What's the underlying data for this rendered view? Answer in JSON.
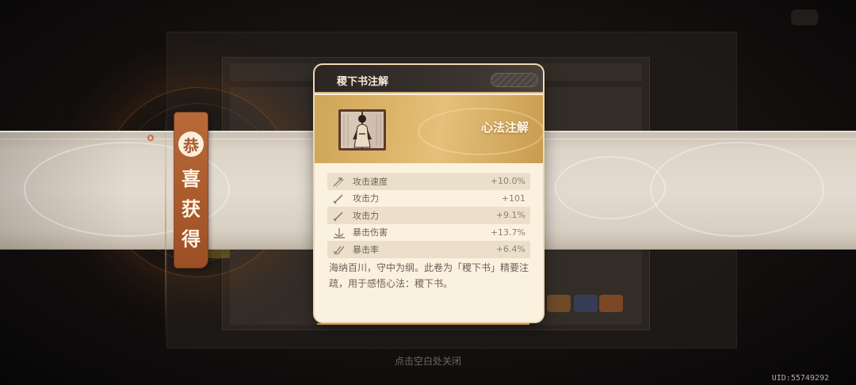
{
  "banner_label": {
    "circle_char": "恭",
    "chars": [
      "喜",
      "获",
      "得"
    ]
  },
  "item": {
    "name": "稷下书注解",
    "type": "心法注解",
    "stats": [
      {
        "icon": "attack-speed-icon",
        "name": "攻击速度",
        "value": "+10.0%"
      },
      {
        "icon": "attack-icon",
        "name": "攻击力",
        "value": "+101"
      },
      {
        "icon": "attack-icon",
        "name": "攻击力",
        "value": "+9.1%"
      },
      {
        "icon": "crit-damage-icon",
        "name": "暴击伤害",
        "value": "+13.7%"
      },
      {
        "icon": "crit-rate-icon",
        "name": "暴击率",
        "value": "+6.4%"
      }
    ],
    "description": "海纳百川，守中为纲。此卷为「稷下书」精要注疏，用于感悟心法：稷下书。"
  },
  "close_hint": "点击空白处关闭",
  "uid": "UID:55749292",
  "colors": {
    "ribbon": "#a95a2b",
    "card_bg": "#fbf1df",
    "banner_gold": "#ddb56a",
    "header_dark": "#2b2624"
  }
}
